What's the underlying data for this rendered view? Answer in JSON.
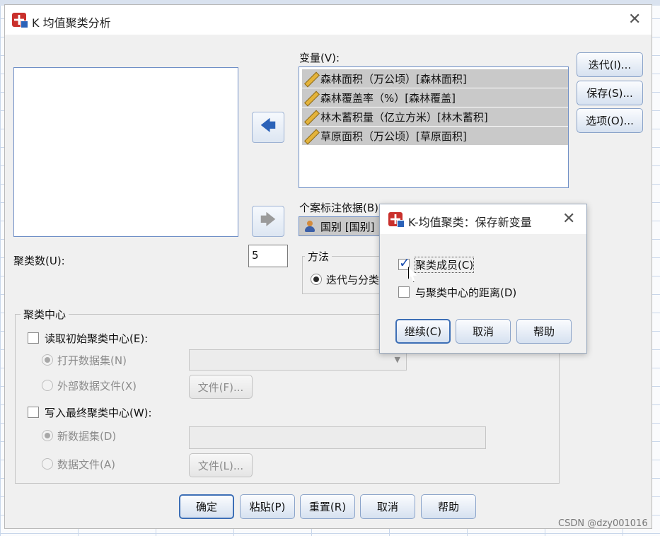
{
  "main_dialog": {
    "title": "K 均值聚类分析",
    "variables_label": "变量(V):",
    "variables": [
      "森林面积（万公顷）[森林面积]",
      "森林覆盖率（%）[森林覆盖]",
      "林木蓄积量（亿立方米）[林木蓄积]",
      "草原面积（万公顷）[草原面积]"
    ],
    "case_label_label": "个案标注依据(B):",
    "case_label_value": "国别 [国别]",
    "clusters_label": "聚类数(U):",
    "clusters_value": "5",
    "method_title": "方法",
    "method_option": "迭代与分类",
    "side_buttons": {
      "iterate": "迭代(I)...",
      "save": "保存(S)...",
      "options": "选项(O)..."
    },
    "cluster_centers": {
      "title": "聚类中心",
      "read_initial": "读取初始聚类中心(E):",
      "open_dataset": "打开数据集(N)",
      "external_file": "外部数据文件(X)",
      "file_btn_1": "文件(F)...",
      "write_final": "写入最终聚类中心(W):",
      "new_dataset": "新数据集(D)",
      "data_file": "数据文件(A)",
      "file_btn_2": "文件(L)..."
    },
    "bottom_buttons": {
      "ok": "确定",
      "paste": "粘贴(P)",
      "reset": "重置(R)",
      "cancel": "取消",
      "help": "帮助"
    }
  },
  "save_dialog": {
    "title": "K-均值聚类：保存新变量",
    "cluster_membership": "聚类成员(C)",
    "distance_from_center": "与聚类中心的距离(D)",
    "buttons": {
      "continue": "继续(C)",
      "cancel": "取消",
      "help": "帮助"
    }
  },
  "watermark": "CSDN @dzy001016",
  "colors": {
    "accent": "#2b62b8",
    "dialog_bg": "#f0f0f0",
    "selected_item": "#c9c9c9"
  }
}
